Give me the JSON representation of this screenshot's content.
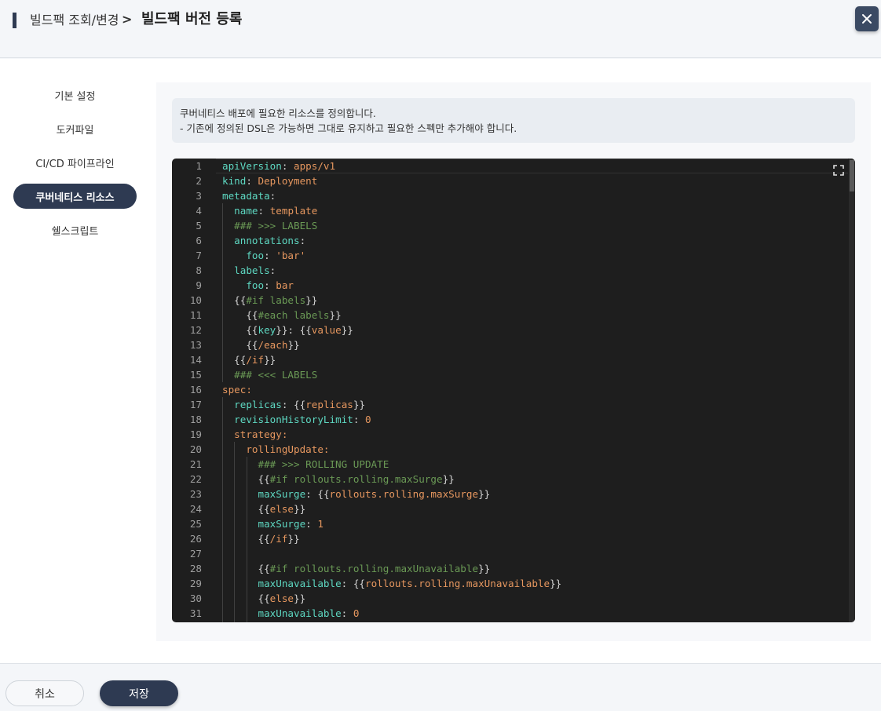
{
  "header": {
    "breadcrumb_parent": "빌드팩 조회/변경",
    "breadcrumb_separator": ">",
    "title": "빌드팩 버전 등록",
    "close_icon": "close-icon"
  },
  "sidebar": {
    "items": [
      {
        "label": "기본 설정",
        "active": false
      },
      {
        "label": "도커파일",
        "active": false
      },
      {
        "label": "CI/CD 파이프라인",
        "active": false
      },
      {
        "label": "쿠버네티스 리소스",
        "active": true
      },
      {
        "label": "쉘스크립트",
        "active": false
      }
    ]
  },
  "notice": {
    "line1": "쿠버네티스 배포에 필요한 리소스를 정의합니다.",
    "line2": "- 기존에 정의된 DSL은 가능하면 그대로 유지하고 필요한 스펙만 추가해야 합니다."
  },
  "editor": {
    "lines": [
      "apiVersion: apps/v1",
      "kind: Deployment",
      "metadata:",
      "  name: template",
      "  ### >>> LABELS",
      "  annotations:",
      "    foo: 'bar'",
      "  labels:",
      "    foo: bar",
      "  {{#if labels}}",
      "    {{#each labels}}",
      "    {{key}}: {{value}}",
      "    {{/each}}",
      "  {{/if}}",
      "  ### <<< LABELS",
      "spec:",
      "  replicas: {{replicas}}",
      "  revisionHistoryLimit: 0",
      "  strategy:",
      "    rollingUpdate:",
      "      ### >>> ROLLING UPDATE",
      "      {{#if rollouts.rolling.maxSurge}}",
      "      maxSurge: {{rollouts.rolling.maxSurge}}",
      "      {{else}}",
      "      maxSurge: 1",
      "      {{/if}}",
      "",
      "      {{#if rollouts.rolling.maxUnavailable}}",
      "      maxUnavailable: {{rollouts.rolling.maxUnavailable}}",
      "      {{else}}",
      "      maxUnavailable: 0"
    ],
    "expand_icon": "expand-icon"
  },
  "footer": {
    "cancel_label": "취소",
    "save_label": "저장"
  },
  "colors": {
    "accent": "#2e3a52",
    "editor_bg": "#1e1e1e",
    "key": "#5ed8c2",
    "value": "#e6975f",
    "comment": "#6a9955"
  }
}
